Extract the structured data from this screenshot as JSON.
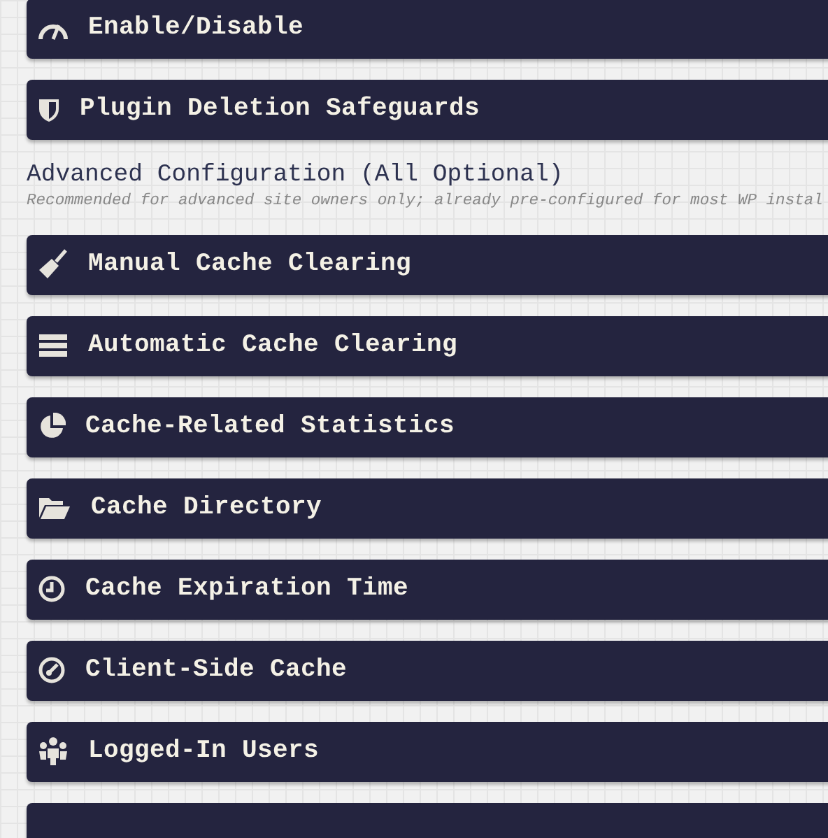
{
  "top_panels": [
    {
      "label": "Enable/Disable"
    },
    {
      "label": "Plugin Deletion Safeguards"
    }
  ],
  "advanced_heading": "Advanced Configuration (All Optional)",
  "advanced_note": "Recommended for advanced site owners only; already pre-configured for most WP instal",
  "advanced_panels": [
    {
      "label": "Manual Cache Clearing"
    },
    {
      "label": "Automatic Cache Clearing"
    },
    {
      "label": "Cache-Related Statistics"
    },
    {
      "label": "Cache Directory"
    },
    {
      "label": "Cache Expiration Time"
    },
    {
      "label": "Client-Side Cache"
    },
    {
      "label": "Logged-In Users"
    }
  ]
}
